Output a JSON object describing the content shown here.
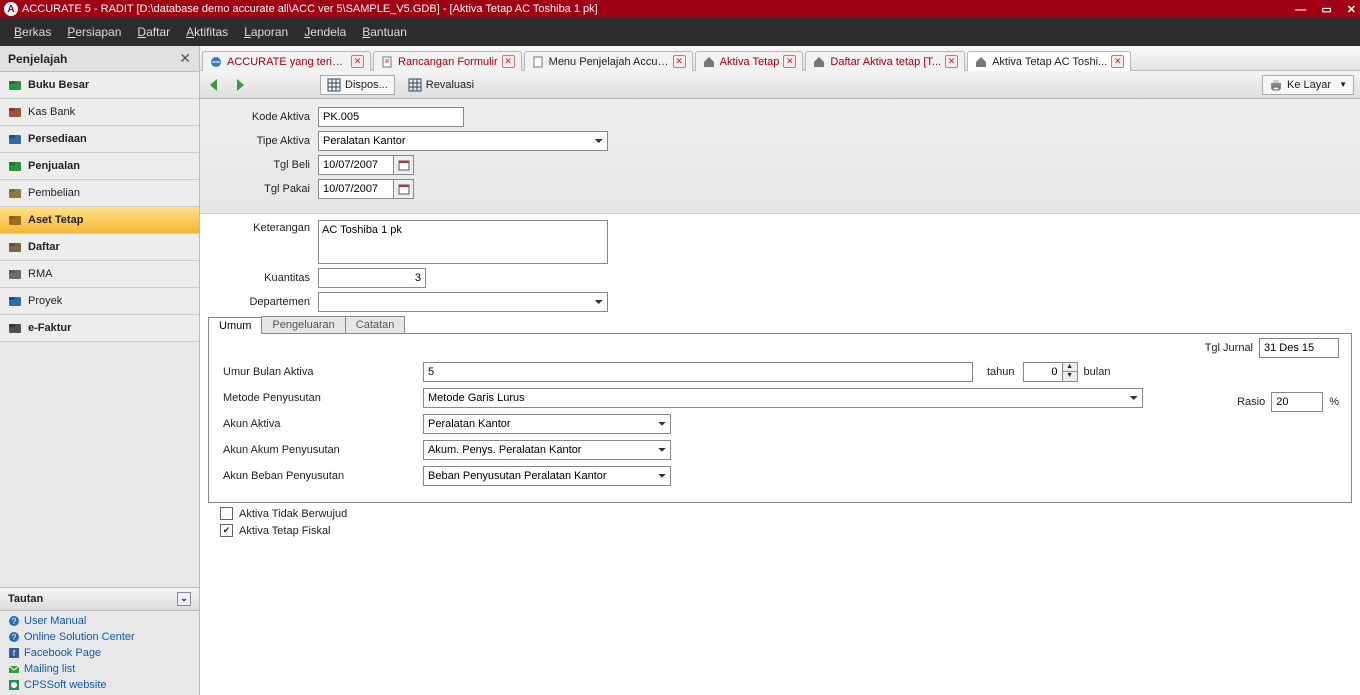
{
  "title": "ACCURATE 5  - RADIT   [D:\\database demo accurate all\\ACC ver 5\\SAMPLE_V5.GDB] - [Aktiva Tetap AC Toshiba 1 pk]",
  "menu": [
    "Berkas",
    "Persiapan",
    "Daftar",
    "Aktifitas",
    "Laporan",
    "Jendela",
    "Bantuan"
  ],
  "explorer": {
    "title": "Penjelajah",
    "items": [
      {
        "label": "Buku Besar",
        "bold": true,
        "color": "#0a7d2a"
      },
      {
        "label": "Kas Bank",
        "bold": false,
        "color": "#8a3a1a"
      },
      {
        "label": "Persediaan",
        "bold": true,
        "color": "#15538f"
      },
      {
        "label": "Penjualan",
        "bold": true,
        "color": "#0a7d2a"
      },
      {
        "label": "Pembelian",
        "bold": false,
        "color": "#7a6a1a"
      },
      {
        "label": "Aset Tetap",
        "bold": true,
        "active": true,
        "color": "#8a5a1a"
      },
      {
        "label": "Daftar",
        "bold": true,
        "color": "#6a4a2a"
      },
      {
        "label": "RMA",
        "bold": false,
        "color": "#555"
      },
      {
        "label": "Proyek",
        "bold": false,
        "color": "#15538f"
      },
      {
        "label": "e-Faktur",
        "bold": true,
        "color": "#333"
      }
    ]
  },
  "tautan": {
    "title": "Tautan",
    "links": [
      "User Manual",
      "Online Solution Center",
      "Facebook Page",
      "Mailing list",
      "CPSSoft website"
    ]
  },
  "docTabs": [
    {
      "label": "ACCURATE yang terinstall t...",
      "red": true,
      "icon": "ie"
    },
    {
      "label": "Rancangan Formulir",
      "red": true,
      "icon": "doc"
    },
    {
      "label": "Menu Penjelajah Accur...",
      "red": false,
      "icon": "page"
    },
    {
      "label": "Aktiva Tetap",
      "red": true,
      "icon": "home"
    },
    {
      "label": "Daftar Aktiva tetap [T...",
      "red": true,
      "icon": "home"
    },
    {
      "label": "Aktiva Tetap AC Toshi...",
      "red": false,
      "icon": "home",
      "active": true
    }
  ],
  "toolbar": {
    "dispos": "Dispos...",
    "reval": "Revaluasi",
    "kelayar": "Ke Layar"
  },
  "form": {
    "labels": {
      "kode": "Kode Aktiva",
      "tipe": "Tipe Aktiva",
      "tglbeli": "Tgl Beli",
      "tglpakai": "Tgl Pakai",
      "ket": "Keterangan",
      "kuant": "Kuantitas",
      "dept": "Departemen"
    },
    "values": {
      "kode": "PK.005",
      "tipe": "Peralatan Kantor",
      "tglbeli": "10/07/2007",
      "tglpakai": "10/07/2007",
      "ket": "AC Toshiba 1 pk",
      "kuant": "3",
      "dept": ""
    }
  },
  "subTabs": [
    "Umum",
    "Pengeluaran",
    "Catatan"
  ],
  "detail": {
    "tglJurnalLabel": "Tgl Jurnal",
    "tglJurnal": "31 Des 15",
    "umurLabel": "Umur Bulan Aktiva",
    "umurTahun": "5",
    "tahunTxt": "tahun",
    "umurBulan": "0",
    "bulanTxt": "bulan",
    "metodeLabel": "Metode Penyusutan",
    "metode": "Metode Garis Lurus",
    "rasioLabel": "Rasio",
    "rasio": "20",
    "rasioUnit": "%",
    "akunAktivaLabel": "Akun Aktiva",
    "akunAktiva": "Peralatan Kantor",
    "akunAkumLabel": "Akun Akum Penyusutan",
    "akunAkum": "Akum. Penys. Peralatan Kantor",
    "akunBebanLabel": "Akun Beban Penyusutan",
    "akunBeban": "Beban Penyusutan Peralatan Kantor"
  },
  "checks": {
    "intangible": {
      "label": "Aktiva Tidak Berwujud",
      "checked": false
    },
    "fiskal": {
      "label": "Aktiva Tetap Fiskal",
      "checked": true
    }
  }
}
